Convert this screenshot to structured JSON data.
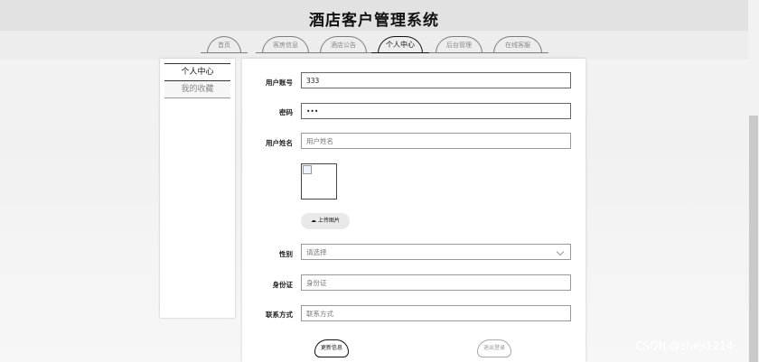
{
  "app": {
    "title": "酒店客户管理系统"
  },
  "nav": {
    "tabs": [
      {
        "label": "首页"
      },
      {
        "label": "客房信息"
      },
      {
        "label": "酒店公告"
      },
      {
        "label": "个人中心"
      },
      {
        "label": "后台管理"
      },
      {
        "label": "在线客服"
      }
    ],
    "active_tab": "个人中心"
  },
  "sidebar": {
    "items": [
      {
        "label": "个人中心"
      },
      {
        "label": "我的收藏"
      }
    ]
  },
  "form": {
    "account": {
      "label": "用户账号",
      "value": "333"
    },
    "password": {
      "label": "密码",
      "value": "•••"
    },
    "name": {
      "label": "用户姓名",
      "value": "",
      "placeholder": "用户姓名"
    },
    "upload": {
      "label": "上传图片",
      "icon": "cloud-upload-icon"
    },
    "gender": {
      "label": "性别",
      "value": "",
      "placeholder": "请选择"
    },
    "id_card": {
      "label": "身份证",
      "value": "",
      "placeholder": "身份证"
    },
    "contact": {
      "label": "联系方式",
      "value": "",
      "placeholder": "联系方式"
    },
    "buttons": {
      "update": "更新信息",
      "logout": "退出登录"
    }
  },
  "watermark": "CSDN @sheji1214",
  "colors": {
    "header_bg": "#e2e2e2",
    "panel_bg": "#ffffff",
    "border": "#666666"
  }
}
